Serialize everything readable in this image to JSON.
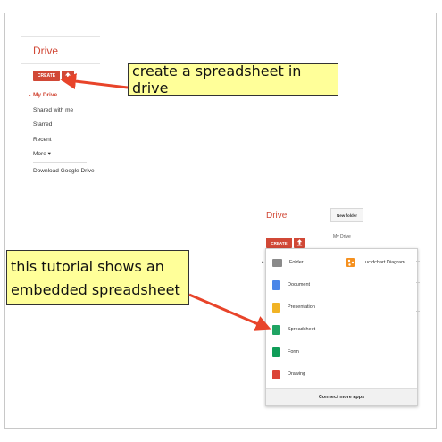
{
  "left": {
    "drive_title": "Drive",
    "create_label": "CREATE",
    "nav": [
      {
        "label": "My Drive",
        "active": true
      },
      {
        "label": "Shared with me"
      },
      {
        "label": "Starred"
      },
      {
        "label": "Recent"
      },
      {
        "label": "More ▾"
      },
      {
        "label": "Download Google Drive"
      }
    ]
  },
  "right": {
    "drive_title": "Drive",
    "create_label": "CREATE",
    "new_folder_label": "New folder",
    "my_drive_column": "My Drive",
    "menu": [
      {
        "label": "Folder",
        "icon": "folder-icon",
        "color": "#8a8a8a"
      },
      {
        "label": "Document",
        "icon": "document-icon",
        "color": "#4a86e8"
      },
      {
        "label": "Presentation",
        "icon": "presentation-icon",
        "color": "#f1b325"
      },
      {
        "label": "Spreadsheet",
        "icon": "spreadsheet-icon",
        "color": "#1fa463"
      },
      {
        "label": "Form",
        "icon": "form-icon",
        "color": "#0f9d58"
      },
      {
        "label": "Drawing",
        "icon": "drawing-icon",
        "color": "#db4437"
      }
    ],
    "lucidchart_label": "Lucidchart Diagram",
    "connect_label": "Connect more apps"
  },
  "callouts": {
    "create": "create a spreadsheet in drive",
    "tutorial_line1": "this tutorial shows an",
    "tutorial_line2": "embedded spreadsheet"
  },
  "colors": {
    "accent": "#d14836",
    "callout_bg": "#ffff99",
    "arrow": "#e8442a"
  }
}
